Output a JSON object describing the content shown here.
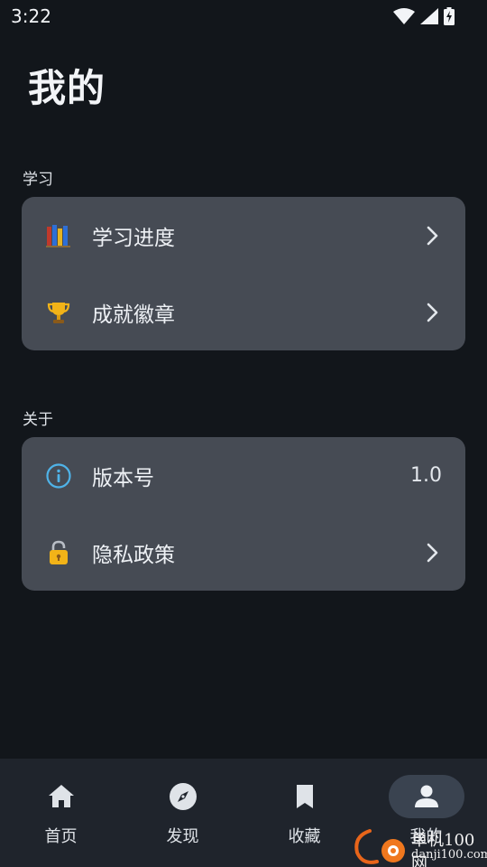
{
  "status_bar": {
    "time": "3:22"
  },
  "header": {
    "title": "我的"
  },
  "sections": [
    {
      "label": "学习",
      "items": [
        {
          "label": "学习进度",
          "icon": "books-icon"
        },
        {
          "label": "成就徽章",
          "icon": "trophy-icon"
        }
      ]
    },
    {
      "label": "关于",
      "items": [
        {
          "label": "版本号",
          "icon": "info-icon",
          "value": "1.0"
        },
        {
          "label": "隐私政策",
          "icon": "lock-icon"
        }
      ]
    }
  ],
  "bottom_nav": {
    "items": [
      {
        "label": "首页",
        "icon": "home-icon"
      },
      {
        "label": "发现",
        "icon": "compass-icon"
      },
      {
        "label": "收藏",
        "icon": "bookmark-icon"
      },
      {
        "label": "我的",
        "icon": "person-icon",
        "active": true
      }
    ]
  },
  "watermark": {
    "line1": "单机100网",
    "line2": "danji100.com"
  },
  "colors": {
    "background": "#12161b",
    "card": "#464b54",
    "nav_background": "#1f242c",
    "active_pill": "#3a4350",
    "info_accent": "#4fb3e8"
  }
}
